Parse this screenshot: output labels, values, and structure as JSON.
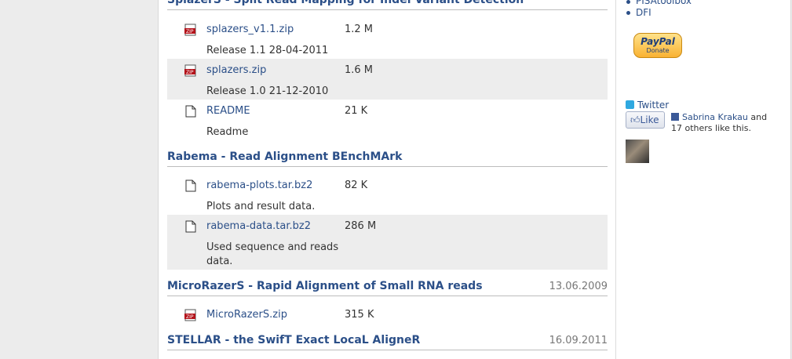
{
  "sections": [
    {
      "title": "SplazerS - Split Read Mapping for Indel Variant Detection",
      "date": "",
      "files": [
        {
          "name": "splazers_v1.1.zip",
          "size": "1.2 M",
          "description": "Release 1.1 28-04-2011",
          "icon": "zip-icon"
        },
        {
          "name": "splazers.zip",
          "size": "1.6 M",
          "description": "Release 1.0 21-12-2010",
          "icon": "zip-icon"
        },
        {
          "name": "README",
          "size": "21 K",
          "description": "Readme",
          "icon": "document-icon"
        }
      ]
    },
    {
      "title": "Rabema - Read Alignment BEnchMArk",
      "date": "",
      "files": [
        {
          "name": "rabema-plots.tar.bz2",
          "size": "82 K",
          "description": "Plots and result data.",
          "icon": "document-icon"
        },
        {
          "name": "rabema-data.tar.bz2",
          "size": "286 M",
          "description": "Used sequence and reads data.",
          "icon": "document-icon"
        }
      ]
    },
    {
      "title": "MicroRazerS - Rapid Alignment of Small RNA reads",
      "date": "13.06.2009",
      "files": [
        {
          "name": "MicroRazerS.zip",
          "size": "315 K",
          "description": "",
          "icon": "zip-icon"
        }
      ]
    },
    {
      "title": "STELLAR - the SwifT Exact LocaL AligneR",
      "date": "16.09.2011",
      "files": []
    }
  ],
  "sidebar": {
    "links": [
      "PISAtoolbox",
      "DFI"
    ],
    "paypal": {
      "brand": "PayPal",
      "label": "Donate"
    },
    "twitter_label": "Twitter",
    "like_button": "Like",
    "like_name": "Sabrina Krakau",
    "like_and": "and",
    "like_others": "17 others like this."
  },
  "colors": {
    "link": "#2b4f88",
    "background": "#ececec",
    "row_shade": "#ededed"
  }
}
